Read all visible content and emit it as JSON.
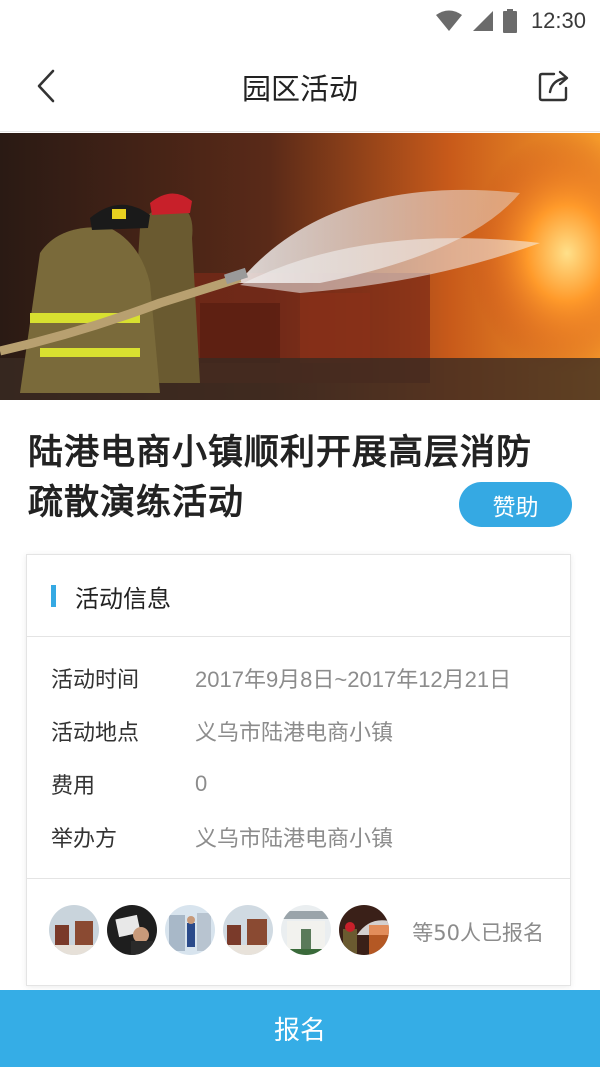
{
  "status_bar": {
    "time": "12:30",
    "icons": [
      "wifi-icon",
      "cellular-signal-icon",
      "battery-icon"
    ]
  },
  "nav": {
    "title": "园区活动",
    "back_icon": "chevron-left-icon",
    "share_icon": "share-icon"
  },
  "hero": {
    "image": "firefighters-spraying-water-at-fire"
  },
  "activity": {
    "title_line1": "陆港电商小镇顺利开展高层消防",
    "title_line2": "疏散演练活动",
    "sponsor_label": "赞助"
  },
  "info": {
    "section_title": "活动信息",
    "rows": [
      {
        "label": "活动时间",
        "value": "2017年9月8日~2017年12月21日"
      },
      {
        "label": "活动地点",
        "value": "义乌市陆港电商小镇"
      },
      {
        "label": "费用",
        "value": "0"
      },
      {
        "label": "举办方",
        "value": "义乌市陆港电商小镇"
      }
    ],
    "participants": {
      "avatar_count": 6,
      "summary": "等50人已报名"
    }
  },
  "footer": {
    "register_label": "报名"
  },
  "colors": {
    "accent": "#35a9e3",
    "footer": "#35ade6",
    "muted_text": "#8c8c8c"
  }
}
